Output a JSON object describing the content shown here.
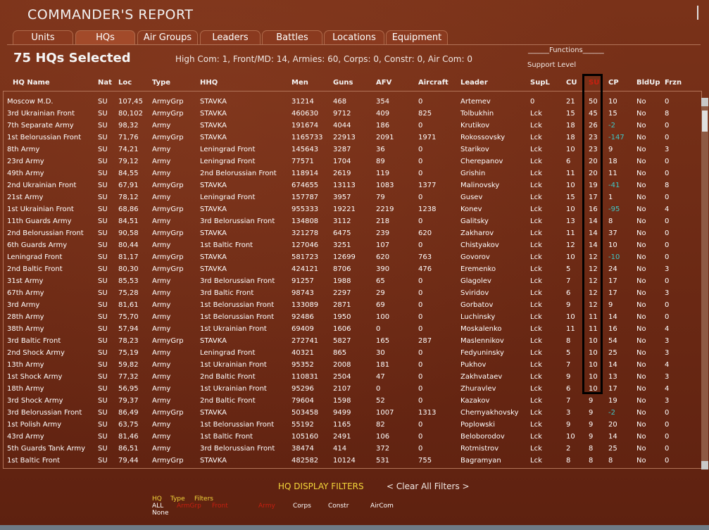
{
  "window": {
    "title": "COMMANDER'S REPORT"
  },
  "tabs": [
    "Units",
    "HQs",
    "Air Groups",
    "Leaders",
    "Battles",
    "Locations",
    "Equipment"
  ],
  "active_tab": "HQs",
  "selection": {
    "count_label": "75 HQs Selected",
    "summary": "High Com: 1, Front/MD: 14, Armies: 60, Corps: 0, Constr: 0, Air Com: 0"
  },
  "functions": {
    "functions_label": "______Functions______",
    "support_label": "Support Level"
  },
  "columns": [
    "HQ Name",
    "Nat",
    "Loc",
    "Type",
    "HHQ",
    "Men",
    "Guns",
    "AFV",
    "Aircraft",
    "Leader",
    "SupL",
    "CU",
    "SU",
    "CP",
    "BldUp",
    "Frzn"
  ],
  "rows": [
    [
      "Moscow M.D.",
      "SU",
      "107,45",
      "ArmyGrp",
      "STAVKA",
      "31214",
      "468",
      "354",
      "0",
      "Artemev",
      "0",
      "21",
      "50",
      "10",
      "No",
      "0"
    ],
    [
      "3rd Ukrainian Front",
      "SU",
      "80,102",
      "ArmyGrp",
      "STAVKA",
      "460630",
      "9712",
      "409",
      "825",
      "Tolbukhin",
      "Lck",
      "15",
      "45",
      "15",
      "No",
      "8"
    ],
    [
      "7th Separate Army",
      "SU",
      "98,32",
      "Army",
      "STAVKA",
      "191674",
      "4044",
      "186",
      "0",
      "Krutikov",
      "Lck",
      "18",
      "26",
      "-2",
      "No",
      "0"
    ],
    [
      "1st Belorussian Front",
      "SU",
      "71,76",
      "ArmyGrp",
      "STAVKA",
      "1165733",
      "22913",
      "2091",
      "1971",
      "Rokossovsky",
      "Lck",
      "18",
      "23",
      "-147",
      "No",
      "0"
    ],
    [
      "8th Army",
      "SU",
      "74,21",
      "Army",
      "Leningrad Front",
      "145643",
      "3287",
      "36",
      "0",
      "Starikov",
      "Lck",
      "10",
      "23",
      "9",
      "No",
      "3"
    ],
    [
      "23rd Army",
      "SU",
      "79,12",
      "Army",
      "Leningrad Front",
      "77571",
      "1704",
      "89",
      "0",
      "Cherepanov",
      "Lck",
      "6",
      "20",
      "18",
      "No",
      "0"
    ],
    [
      "49th Army",
      "SU",
      "84,55",
      "Army",
      "2nd Belorussian Front",
      "118914",
      "2619",
      "119",
      "0",
      "Grishin",
      "Lck",
      "11",
      "20",
      "11",
      "No",
      "0"
    ],
    [
      "2nd Ukrainian Front",
      "SU",
      "67,91",
      "ArmyGrp",
      "STAVKA",
      "674655",
      "13113",
      "1083",
      "1377",
      "Malinovsky",
      "Lck",
      "10",
      "19",
      "-41",
      "No",
      "8"
    ],
    [
      "21st Army",
      "SU",
      "78,12",
      "Army",
      "Leningrad Front",
      "157787",
      "3957",
      "79",
      "0",
      "Gusev",
      "Lck",
      "15",
      "17",
      "1",
      "No",
      "0"
    ],
    [
      "1st Ukrainian Front",
      "SU",
      "68,86",
      "ArmyGrp",
      "STAVKA",
      "955333",
      "19221",
      "2219",
      "1238",
      "Konev",
      "Lck",
      "10",
      "16",
      "-95",
      "No",
      "4"
    ],
    [
      "11th Guards Army",
      "SU",
      "84,51",
      "Army",
      "3rd Belorussian Front",
      "134808",
      "3112",
      "218",
      "0",
      "Galitsky",
      "Lck",
      "13",
      "14",
      "8",
      "No",
      "0"
    ],
    [
      "2nd Belorussian Front",
      "SU",
      "90,58",
      "ArmyGrp",
      "STAVKA",
      "321278",
      "6475",
      "239",
      "620",
      "Zakharov",
      "Lck",
      "11",
      "14",
      "37",
      "No",
      "0"
    ],
    [
      "6th Guards Army",
      "SU",
      "80,44",
      "Army",
      "1st Baltic Front",
      "127046",
      "3251",
      "107",
      "0",
      "Chistyakov",
      "Lck",
      "12",
      "14",
      "10",
      "No",
      "0"
    ],
    [
      "Leningrad Front",
      "SU",
      "81,17",
      "ArmyGrp",
      "STAVKA",
      "581723",
      "12699",
      "620",
      "763",
      "Govorov",
      "Lck",
      "10",
      "12",
      "-10",
      "No",
      "0"
    ],
    [
      "2nd Baltic Front",
      "SU",
      "80,30",
      "ArmyGrp",
      "STAVKA",
      "424121",
      "8706",
      "390",
      "476",
      "Eremenko",
      "Lck",
      "5",
      "12",
      "24",
      "No",
      "3"
    ],
    [
      "31st Army",
      "SU",
      "85,53",
      "Army",
      "3rd Belorussian Front",
      "91257",
      "1988",
      "65",
      "0",
      "Glagolev",
      "Lck",
      "7",
      "12",
      "17",
      "No",
      "0"
    ],
    [
      "67th Army",
      "SU",
      "75,28",
      "Army",
      "3rd Baltic Front",
      "98743",
      "2297",
      "29",
      "0",
      "Sviridov",
      "Lck",
      "6",
      "12",
      "17",
      "No",
      "3"
    ],
    [
      "3rd Army",
      "SU",
      "81,61",
      "Army",
      "1st Belorussian Front",
      "133089",
      "2871",
      "69",
      "0",
      "Gorbatov",
      "Lck",
      "9",
      "12",
      "9",
      "No",
      "0"
    ],
    [
      "28th Army",
      "SU",
      "75,70",
      "Army",
      "1st Belorussian Front",
      "92486",
      "1950",
      "100",
      "0",
      "Luchinsky",
      "Lck",
      "10",
      "11",
      "14",
      "No",
      "0"
    ],
    [
      "38th Army",
      "SU",
      "57,94",
      "Army",
      "1st Ukrainian Front",
      "69409",
      "1606",
      "0",
      "0",
      "Moskalenko",
      "Lck",
      "11",
      "11",
      "16",
      "No",
      "4"
    ],
    [
      "3rd Baltic Front",
      "SU",
      "78,23",
      "ArmyGrp",
      "STAVKA",
      "272741",
      "5827",
      "165",
      "287",
      "Maslennikov",
      "Lck",
      "8",
      "10",
      "54",
      "No",
      "3"
    ],
    [
      "2nd Shock Army",
      "SU",
      "75,19",
      "Army",
      "Leningrad Front",
      "40321",
      "865",
      "30",
      "0",
      "Fedyuninsky",
      "Lck",
      "5",
      "10",
      "25",
      "No",
      "3"
    ],
    [
      "13th Army",
      "SU",
      "59,82",
      "Army",
      "1st Ukrainian Front",
      "95352",
      "2008",
      "181",
      "0",
      "Pukhov",
      "Lck",
      "7",
      "10",
      "14",
      "No",
      "4"
    ],
    [
      "1st Shock Army",
      "SU",
      "77,32",
      "Army",
      "2nd Baltic Front",
      "110831",
      "2504",
      "47",
      "0",
      "Zakhvataev",
      "Lck",
      "9",
      "10",
      "13",
      "No",
      "3"
    ],
    [
      "18th Army",
      "SU",
      "56,95",
      "Army",
      "1st Ukrainian Front",
      "95296",
      "2107",
      "0",
      "0",
      "Zhuravlev",
      "Lck",
      "6",
      "10",
      "17",
      "No",
      "4"
    ],
    [
      "3rd Shock Army",
      "SU",
      "79,37",
      "Army",
      "2nd Baltic Front",
      "79604",
      "1598",
      "52",
      "0",
      "Kazakov",
      "Lck",
      "7",
      "9",
      "19",
      "No",
      "3"
    ],
    [
      "3rd Belorussian Front",
      "SU",
      "86,49",
      "ArmyGrp",
      "STAVKA",
      "503458",
      "9499",
      "1007",
      "1313",
      "Chernyakhovsky",
      "Lck",
      "3",
      "9",
      "-2",
      "No",
      "0"
    ],
    [
      "1st Polish Army",
      "SU",
      "63,75",
      "Army",
      "1st Belorussian Front",
      "55192",
      "1165",
      "82",
      "0",
      "Poplowski",
      "Lck",
      "9",
      "9",
      "20",
      "No",
      "0"
    ],
    [
      "43rd Army",
      "SU",
      "81,46",
      "Army",
      "1st Baltic Front",
      "105160",
      "2491",
      "106",
      "0",
      "Beloborodov",
      "Lck",
      "10",
      "9",
      "14",
      "No",
      "0"
    ],
    [
      "5th Guards Tank Army",
      "SU",
      "86,51",
      "Army",
      "3rd Belorussian Front",
      "38474",
      "414",
      "372",
      "0",
      "Rotmistrov",
      "Lck",
      "2",
      "8",
      "25",
      "No",
      "0"
    ],
    [
      "1st Baltic Front",
      "SU",
      "79,44",
      "ArmyGrp",
      "STAVKA",
      "482582",
      "10124",
      "531",
      "755",
      "Bagramyan",
      "Lck",
      "8",
      "8",
      "8",
      "No",
      "0"
    ]
  ],
  "footer": {
    "filters_title": "HQ DISPLAY FILTERS",
    "clear_filters": "< Clear All Filters >",
    "hq_label": "HQ",
    "type_label": "Type",
    "filters_label": "Filters",
    "all_label": "ALL",
    "none_label": "None",
    "type_filters": [
      "ArmGrp",
      "Front",
      "Army",
      "Corps",
      "Constr",
      "AirCom"
    ]
  },
  "colors": {
    "background": "#6e2a14",
    "accent": "#f3d63a",
    "negative_cp": "#3fc7c7",
    "active_filter": "#c81f10"
  }
}
